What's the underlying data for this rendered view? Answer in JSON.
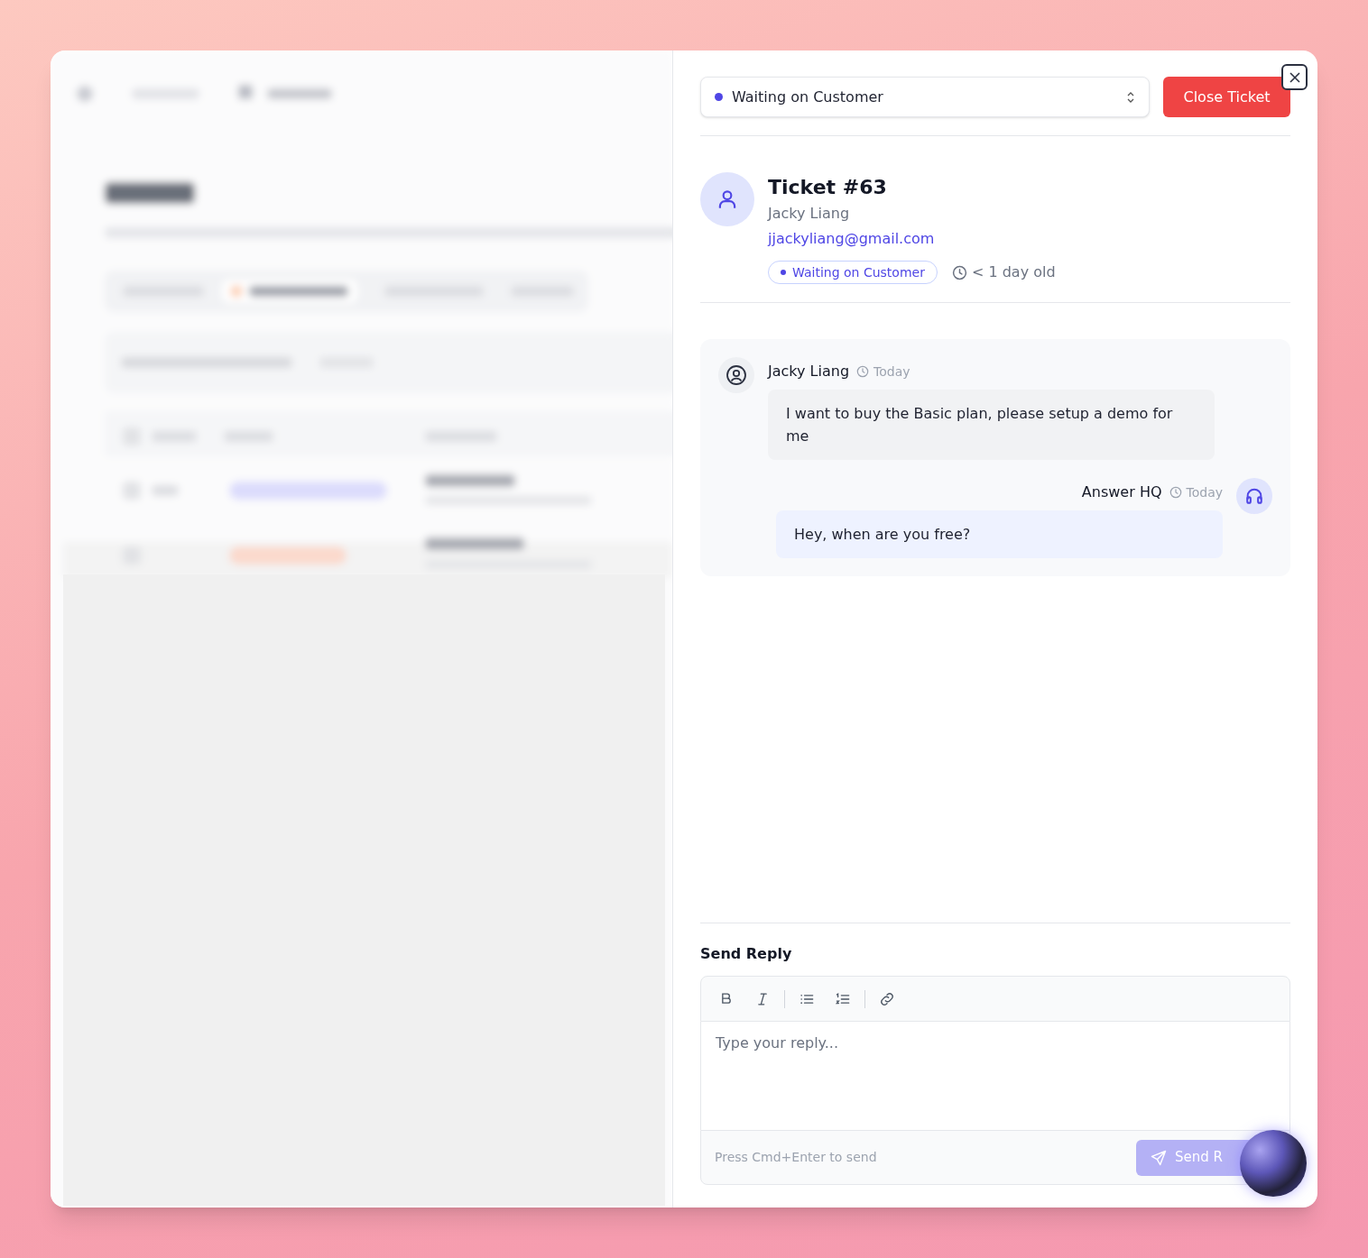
{
  "status_select": {
    "value": "Waiting on Customer"
  },
  "close_button": "Close Ticket",
  "ticket": {
    "title": "Ticket #63",
    "name": "Jacky Liang",
    "email": "jjackyliang@gmail.com",
    "status_badge": "Waiting on Customer",
    "age": "< 1 day old"
  },
  "messages": [
    {
      "kind": "customer",
      "author": "Jacky Liang",
      "time": "Today",
      "text": "I want to buy the Basic plan, please setup a demo for me"
    },
    {
      "kind": "agent",
      "author": "Answer HQ",
      "time": "Today",
      "text": "Hey, when are you free?"
    }
  ],
  "reply": {
    "heading": "Send Reply",
    "placeholder": "Type your reply...",
    "hint": "Press Cmd+Enter to send",
    "send_button": "Send R",
    "disabled": true
  }
}
